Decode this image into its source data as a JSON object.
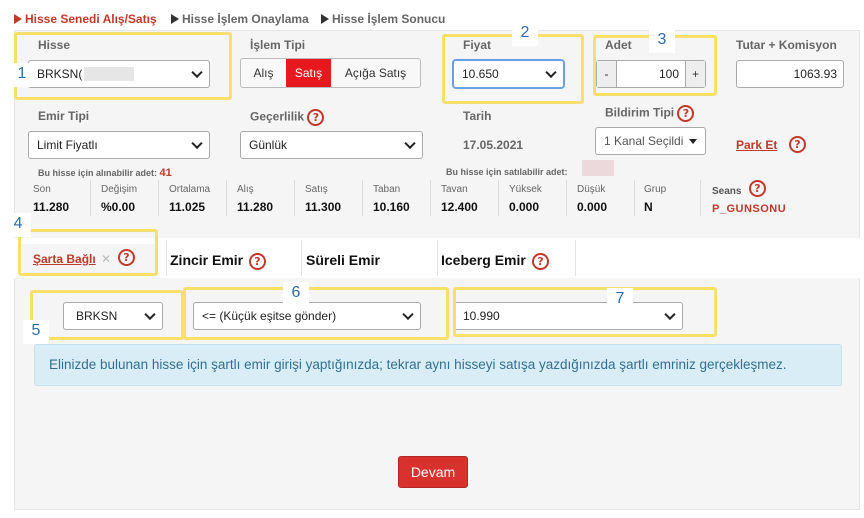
{
  "steps": [
    "Hisse Senedi Alış/Satış",
    "Hisse İşlem Onaylama",
    "Hisse İşlem Sonucu"
  ],
  "form": {
    "hisse_label": "Hisse",
    "hisse_value": "BRKSN(",
    "islem_tipi_label": "İşlem Tipi",
    "islem_buttons": [
      "Alış",
      "Satış",
      "Açığa Satış"
    ],
    "fiyat_label": "Fiyat",
    "fiyat_value": "10.650",
    "adet_label": "Adet",
    "adet_value": "100",
    "adet_minus": "-",
    "adet_plus": "+",
    "tutar_label": "Tutar + Komisyon",
    "tutar_value": "1063.93",
    "emir_tipi_label": "Emir Tipi",
    "emir_tipi_value": "Limit Fiyatlı",
    "gecerlilik_label": "Geçerlilik",
    "gecerlilik_value": "Günlük",
    "tarih_label": "Tarih",
    "tarih_value": "17.05.2021",
    "bildirim_label": "Bildirim Tipi",
    "bildirim_value": "1 Kanal Seçildi",
    "park_et": "Park Et",
    "alinabilir_text": "Bu hisse için alınabilir adet:",
    "alinabilir_value": "41",
    "satilabilir_text": "Bu hisse için satılabilir adet:"
  },
  "help_glyph": "?",
  "stats": [
    {
      "label": "Son",
      "value": "11.280"
    },
    {
      "label": "Değişim",
      "value": "%0.00"
    },
    {
      "label": "Ortalama",
      "value": "11.025"
    },
    {
      "label": "Alış",
      "value": "11.280"
    },
    {
      "label": "Satış",
      "value": "11.300"
    },
    {
      "label": "Taban",
      "value": "10.160"
    },
    {
      "label": "Tavan",
      "value": "12.400"
    },
    {
      "label": "Yüksek",
      "value": "0.000"
    },
    {
      "label": "Düşük",
      "value": "0.000"
    },
    {
      "label": "Grup",
      "value": "N"
    }
  ],
  "seans": {
    "label": "Seans",
    "value": "P_GUNSONU"
  },
  "tabs": {
    "sarta_bagli": "Şarta Bağlı",
    "close": "✕",
    "zincir": "Zincir Emir",
    "sureli": "Süreli Emir",
    "iceberg": "Iceberg Emir"
  },
  "condition": {
    "symbol": "BRKSN",
    "operator": "<= (Küçük eşitse gönder)",
    "price": "10.990"
  },
  "info_text": "Elinizde bulunan hisse için şartlı emir girişi yaptığınızda; tekrar aynı hisseyi satışa yazdığınızda şartlı emriniz gerçekleşmez.",
  "submit_label": "Devam",
  "annotations": [
    "1",
    "2",
    "3",
    "4",
    "5",
    "6",
    "7"
  ],
  "colors": {
    "accent_red": "#c0392b",
    "highlight": "#f7df6c",
    "info_bg": "#d9edf7",
    "button_red": "#d9312e"
  }
}
